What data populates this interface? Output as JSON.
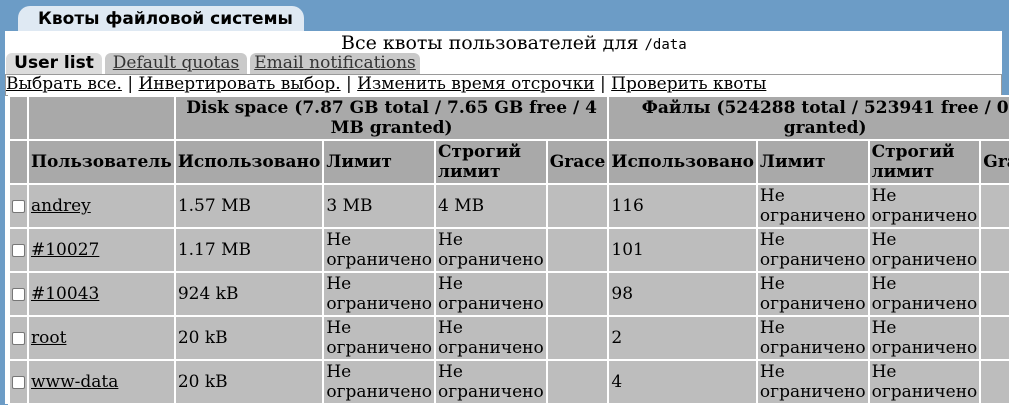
{
  "window_tab": "Квоты файловой системы",
  "subtitle": {
    "text": "Все квоты пользователей для ",
    "path": "/data"
  },
  "tabs": [
    {
      "label": "User list",
      "active": true
    },
    {
      "label": "Default quotas",
      "active": false
    },
    {
      "label": "Email notifications",
      "active": false
    }
  ],
  "actions": {
    "select_all": "Выбрать все.",
    "invert": "Инвертировать выбор.",
    "grace": "Изменить время отсрочки",
    "check": "Проверить квоты",
    "sep": "|"
  },
  "table": {
    "disk_header": "Disk space (7.87 GB total / 7.65 GB free / 4 MB granted)",
    "files_header": "Файлы (524288 total / 523941 free / 0 granted)",
    "columns": {
      "user": "Пользователь",
      "used": "Использовано",
      "limit": "Лимит",
      "hard": "Строгий лимит",
      "grace": "Grace"
    },
    "rows": [
      {
        "user": "andrey",
        "disk_used": "1.57 MB",
        "disk_limit": "3 MB",
        "disk_hard": "4 MB",
        "disk_grace": "",
        "files_used": "116",
        "files_limit": "Не ограничено",
        "files_hard": "Не ограничено",
        "files_grace": ""
      },
      {
        "user": "#10027",
        "disk_used": "1.17 MB",
        "disk_limit": "Не ограничено",
        "disk_hard": "Не ограничено",
        "disk_grace": "",
        "files_used": "101",
        "files_limit": "Не ограничено",
        "files_hard": "Не ограничено",
        "files_grace": ""
      },
      {
        "user": "#10043",
        "disk_used": "924 kB",
        "disk_limit": "Не ограничено",
        "disk_hard": "Не ограничено",
        "disk_grace": "",
        "files_used": "98",
        "files_limit": "Не ограничено",
        "files_hard": "Не ограничено",
        "files_grace": ""
      },
      {
        "user": "root",
        "disk_used": "20 kB",
        "disk_limit": "Не ограничено",
        "disk_hard": "Не ограничено",
        "disk_grace": "",
        "files_used": "2",
        "files_limit": "Не ограничено",
        "files_hard": "Не ограничено",
        "files_grace": ""
      },
      {
        "user": "www-data",
        "disk_used": "20 kB",
        "disk_limit": "Не ограничено",
        "disk_hard": "Не ограничено",
        "disk_grace": "",
        "files_used": "4",
        "files_limit": "Не ограничено",
        "files_hard": "Не ограничено",
        "files_grace": ""
      }
    ]
  }
}
